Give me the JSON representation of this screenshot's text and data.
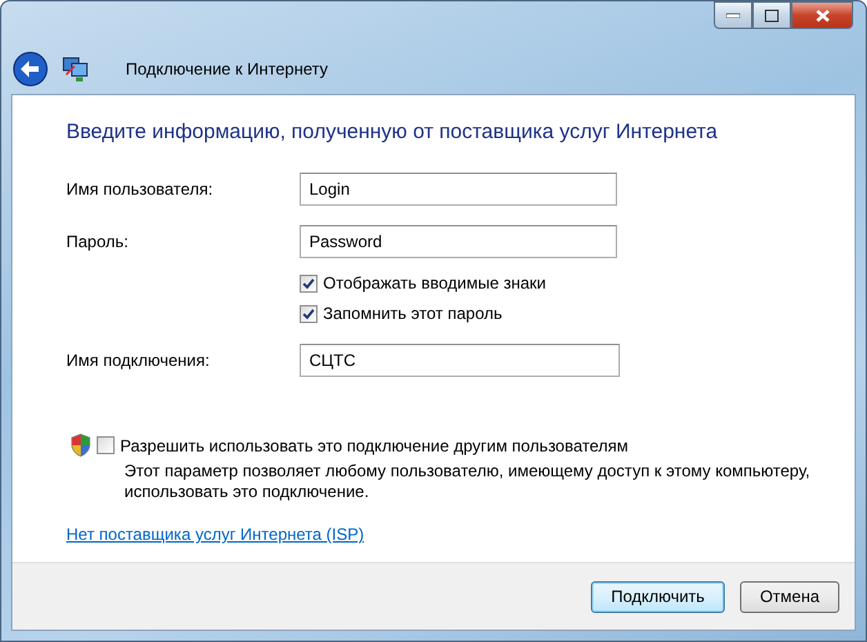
{
  "window": {
    "title": "Подключение к Интернету"
  },
  "heading": "Введите информацию, полученную от поставщика услуг Интернета",
  "fields": [
    {
      "label": "Имя пользователя:",
      "value": "Login"
    },
    {
      "label": "Пароль:",
      "value": "Password"
    }
  ],
  "options": [
    {
      "label": "Отображать вводимые знаки",
      "checked": true
    },
    {
      "label": "Запомнить этот пароль",
      "checked": true
    }
  ],
  "connection_name": {
    "label": "Имя подключения:",
    "value": "СЦТС"
  },
  "share": {
    "label": "Разрешить использовать это подключение другим пользователям",
    "checked": false,
    "description": "Этот параметр позволяет любому пользователю, имеющему доступ к этому компьютеру, использовать это подключение."
  },
  "link": "Нет поставщика услуг Интернета (ISP)",
  "buttons": [
    {
      "label": "Подключить",
      "kind": "default"
    },
    {
      "label": "Отмена",
      "kind": "normal"
    }
  ]
}
